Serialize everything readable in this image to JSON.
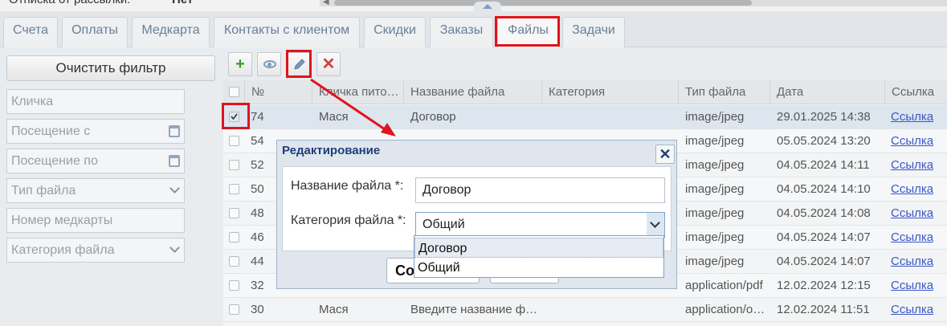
{
  "top_filter": {
    "label": "Отписка от рассылки:",
    "value": "Нет"
  },
  "tabs": [
    {
      "label": "Счета"
    },
    {
      "label": "Оплаты"
    },
    {
      "label": "Медкарта"
    },
    {
      "label": "Контакты с клиентом"
    },
    {
      "label": "Скидки"
    },
    {
      "label": "Заказы"
    },
    {
      "label": "Файлы",
      "active": true
    },
    {
      "label": "Задачи"
    }
  ],
  "sidebar": {
    "clear_label": "Очистить фильтр",
    "fields": [
      {
        "placeholder": "Кличка"
      },
      {
        "placeholder": "Посещение с"
      },
      {
        "placeholder": "Посещение по"
      },
      {
        "placeholder": "Тип файла"
      },
      {
        "placeholder": "Номер медкарты"
      },
      {
        "placeholder": "Категория файла"
      }
    ]
  },
  "toolbar": {
    "add": "+",
    "delete": "✕"
  },
  "table": {
    "headers": [
      "№",
      "Кличка пито…",
      "Название файла",
      "Категория",
      "Тип файла",
      "Дата",
      "Ссылка"
    ],
    "rows": [
      {
        "num": "74",
        "pet": "Мася",
        "name": "Договор",
        "cat": "",
        "type": "image/jpeg",
        "date": "29.01.2025 14:38",
        "link": "Ссылка",
        "checked": true
      },
      {
        "num": "54",
        "pet": "",
        "name": "",
        "cat": "",
        "type": "image/jpeg",
        "date": "05.05.2024 13:20",
        "link": "Ссылка"
      },
      {
        "num": "52",
        "pet": "",
        "name": "",
        "cat": "",
        "type": "image/jpeg",
        "date": "04.05.2024 14:11",
        "link": "Ссылка"
      },
      {
        "num": "50",
        "pet": "",
        "name": "",
        "cat": "",
        "type": "image/jpeg",
        "date": "04.05.2024 14:10",
        "link": "Ссылка"
      },
      {
        "num": "48",
        "pet": "",
        "name": "",
        "cat": "",
        "type": "image/jpeg",
        "date": "04.05.2024 14:08",
        "link": "Ссылка"
      },
      {
        "num": "46",
        "pet": "",
        "name": "",
        "cat": "",
        "type": "image/jpeg",
        "date": "04.05.2024 14:07",
        "link": "Ссылка"
      },
      {
        "num": "44",
        "pet": "",
        "name": "",
        "cat": "",
        "type": "image/jpeg",
        "date": "04.05.2024 14:07",
        "link": "Ссылка"
      },
      {
        "num": "32",
        "pet": "",
        "name": "",
        "cat": "",
        "type": "application/pdf",
        "date": "12.02.2024 12:15",
        "link": "Ссылка"
      },
      {
        "num": "30",
        "pet": "Мася",
        "name": "Введите название ф…",
        "cat": "",
        "type": "application/o…",
        "date": "12.02.2024 11:51",
        "link": "Ссылка"
      }
    ]
  },
  "modal": {
    "title": "Редактирование",
    "close": "✕",
    "name_label": "Название файла *:",
    "name_value": "Договор",
    "category_label": "Категория файла *:",
    "category_value": "Общий",
    "save_label": "Со",
    "options": [
      "Договор",
      "Общий"
    ]
  },
  "colors": {
    "highlight": "#e0141b",
    "link": "#3a57c6",
    "title": "#1e3f77"
  }
}
